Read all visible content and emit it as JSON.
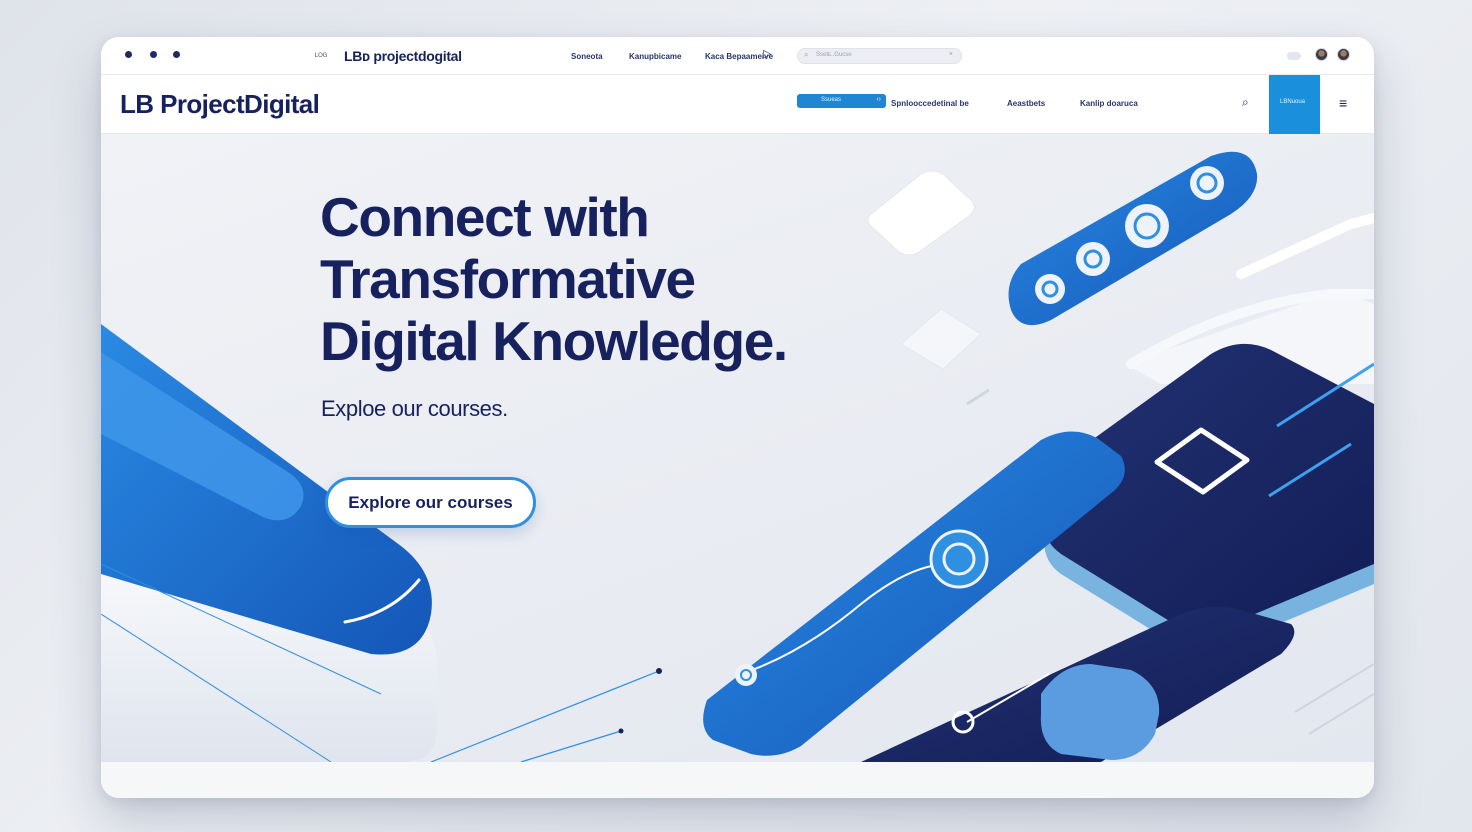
{
  "browser": {
    "prefix": "ᴸᴼᴳ",
    "brand": "LBᴅ projectdogital",
    "links": [
      "Soneota",
      "Kanupbicame",
      "Kaca Bepaameive"
    ],
    "search_placeholder": "Ssetᴇ..Gucsʜ"
  },
  "nav": {
    "logo": "LB ProjectDigital",
    "pill_label": "Ssueas",
    "pill_code": "‹›",
    "links": [
      "Spnlooccedetinal be",
      "Aeastbets",
      "Kanlip doaruca"
    ],
    "cta_label": "LBNuoua"
  },
  "hero": {
    "title_lines": [
      "Connect with",
      "Transformative",
      "Digital Knowledge."
    ],
    "subtitle": "Exploe our courses.",
    "button_label": "Explore our courses"
  },
  "colors": {
    "navy": "#16215e",
    "accent": "#1f86d4",
    "accent_light": "#2f8fe0",
    "background": "#eceef3"
  },
  "icons": [
    "window-dot-icon",
    "play-icon",
    "search-icon",
    "cloud-icon",
    "avatar",
    "menu-icon"
  ]
}
